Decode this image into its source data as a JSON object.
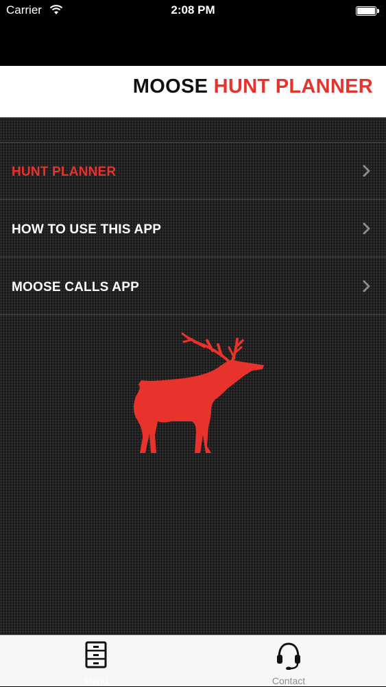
{
  "status_bar": {
    "carrier": "Carrier",
    "time": "2:08 PM"
  },
  "header": {
    "title_part1": "MOOSE",
    "title_part2": "HUNT PLANNER"
  },
  "menu": {
    "items": [
      {
        "label": "HUNT PLANNER",
        "active": true
      },
      {
        "label": "HOW TO USE THIS APP",
        "active": false
      },
      {
        "label": "MOOSE CALLS APP",
        "active": false
      }
    ]
  },
  "tab_bar": {
    "tabs": [
      {
        "label": "Menu",
        "icon": "file-cabinet-icon",
        "selected": true
      },
      {
        "label": "Contact",
        "icon": "headset-icon",
        "selected": false
      }
    ]
  },
  "colors": {
    "accent": "#e8322c",
    "background": "#1b1b1b",
    "header_bg": "#ffffff"
  }
}
